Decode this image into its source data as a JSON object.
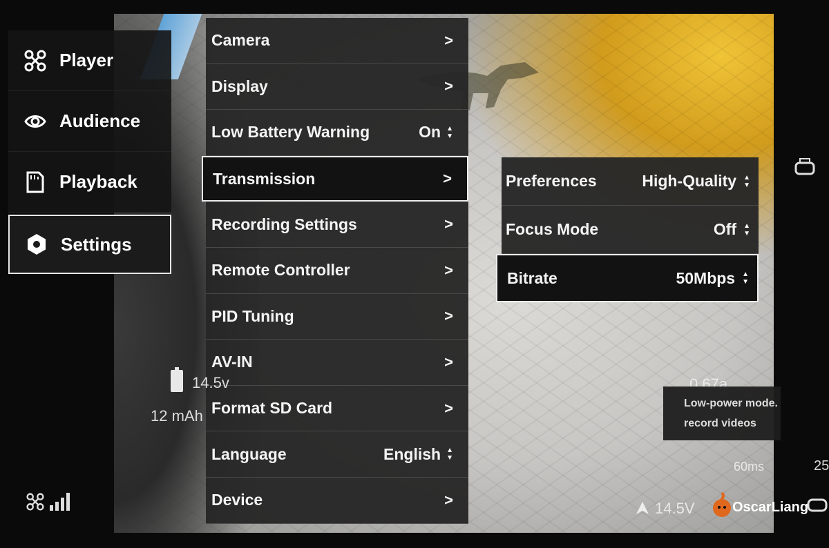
{
  "sidebar": {
    "items": [
      {
        "label": "Player",
        "icon": "drone-icon",
        "active": false
      },
      {
        "label": "Audience",
        "icon": "eye-icon",
        "active": false
      },
      {
        "label": "Playback",
        "icon": "sd-card-icon",
        "active": false
      },
      {
        "label": "Settings",
        "icon": "hexagon-settings-icon",
        "active": true
      }
    ]
  },
  "menu": {
    "items": [
      {
        "label": "Camera",
        "value": ">"
      },
      {
        "label": "Display",
        "value": ">"
      },
      {
        "label": "Low Battery Warning",
        "value": "On"
      },
      {
        "label": "Transmission",
        "value": ">"
      },
      {
        "label": "Recording Settings",
        "value": ">"
      },
      {
        "label": "Remote Controller",
        "value": ">"
      },
      {
        "label": "PID Tuning",
        "value": ">"
      },
      {
        "label": "AV-IN",
        "value": ">"
      },
      {
        "label": "Format SD Card",
        "value": ">"
      },
      {
        "label": "Language",
        "value": "English"
      },
      {
        "label": "Device",
        "value": ">"
      }
    ]
  },
  "submenu": {
    "items": [
      {
        "label": "Preferences",
        "value": "High-Quality"
      },
      {
        "label": "Focus Mode",
        "value": "Off"
      },
      {
        "label": "Bitrate",
        "value": "50Mbps"
      }
    ]
  },
  "osd": {
    "battery_voltage": "14.5v",
    "capacity": "12 mAh",
    "current": "0.67a",
    "latency": "60ms",
    "right_value": "25",
    "voltage_bottom": "14.5V",
    "watermark": "OscarLiang"
  },
  "warning": {
    "line1": "Low-power mode. Unable",
    "line2": "record videos"
  },
  "colors": {
    "menu_bg": "#262626",
    "selected_border": "#eeeeee",
    "warning_icon": "#f2c230"
  }
}
